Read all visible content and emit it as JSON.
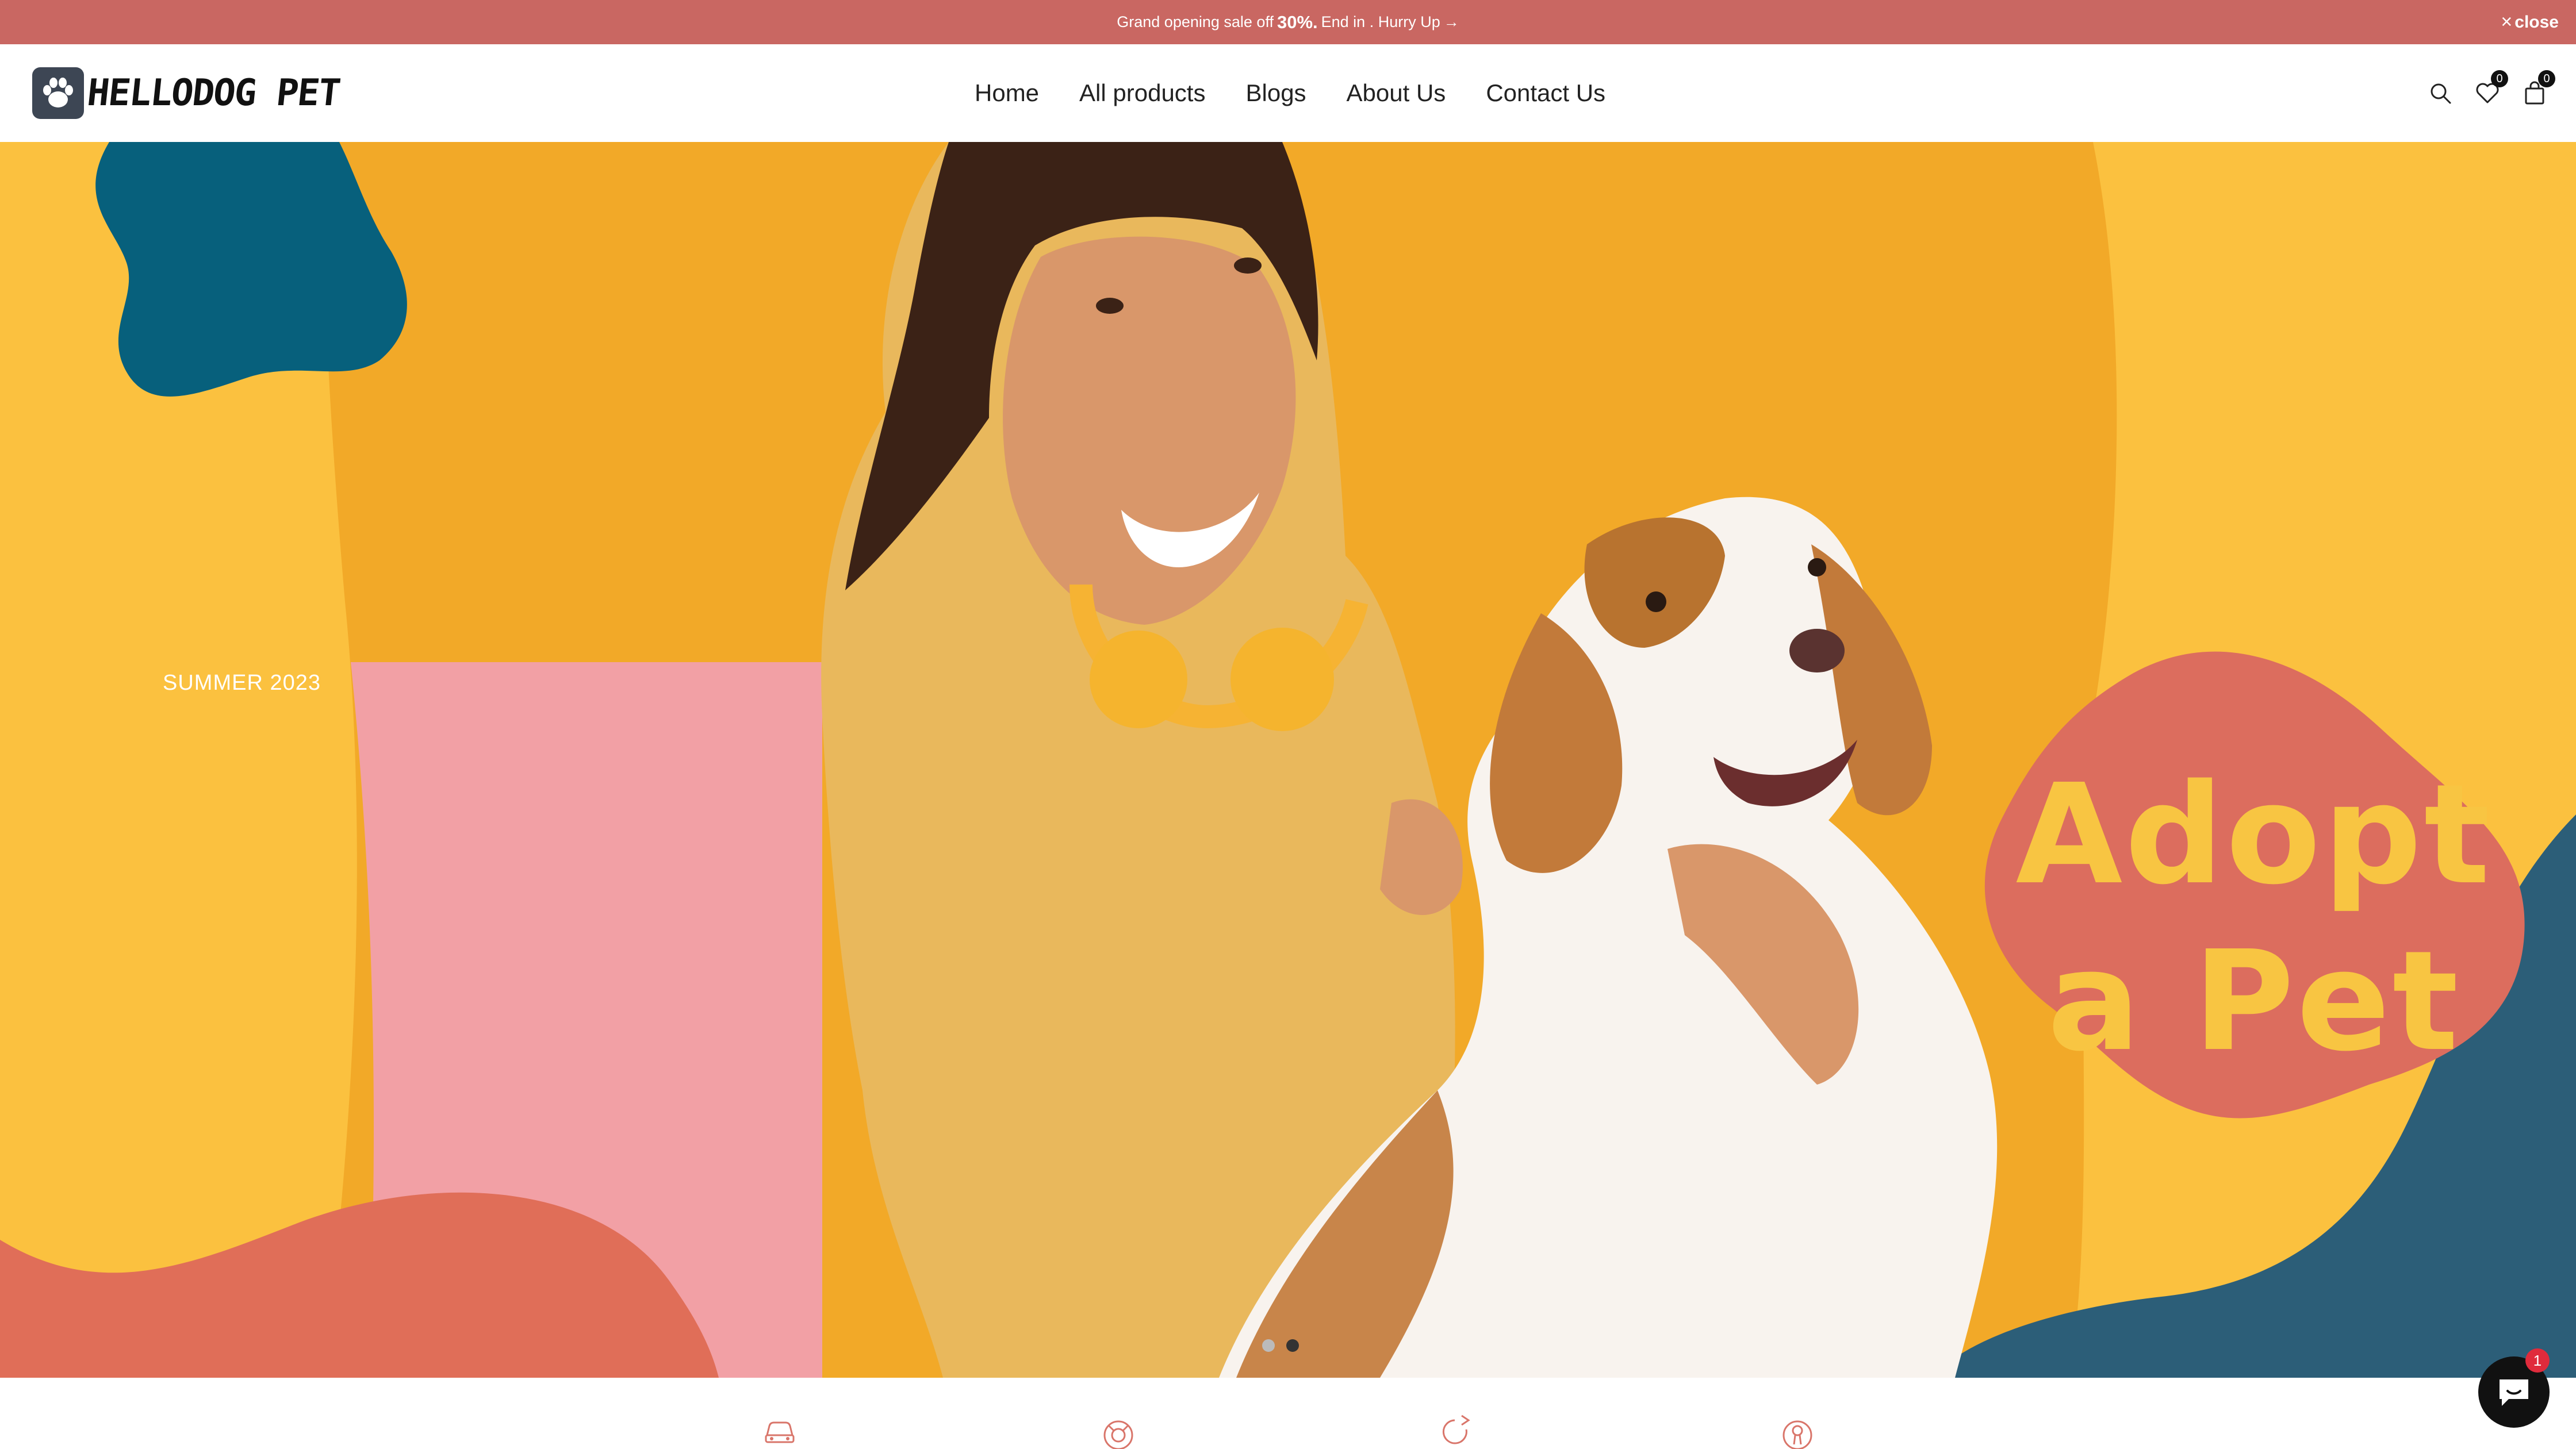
{
  "announcement": {
    "prefix": "Grand opening sale off",
    "discount": "30%.",
    "suffix": "End in . Hurry Up",
    "arrow": "→",
    "close_label": "close",
    "close_icon": "×"
  },
  "header": {
    "logo_text": "HELLODOG PET",
    "logo_icon": "paw-icon",
    "nav": [
      {
        "label": "Home"
      },
      {
        "label": "All products"
      },
      {
        "label": "Blogs"
      },
      {
        "label": "About Us"
      },
      {
        "label": "Contact Us"
      }
    ],
    "wishlist_count": "0",
    "cart_count": "0"
  },
  "hero": {
    "season": "SUMMER 2023",
    "headline_line1": "Adopt",
    "headline_line2": "a Pet",
    "slide_count": 2,
    "active_slide": 2,
    "colors": {
      "orange": "#f2a928",
      "yellow": "#fbc13f",
      "pink": "#f2a0a5",
      "coral": "#e06e58",
      "teal": "#2c5e78",
      "dark_teal": "#07607c",
      "badge_red": "#dc6d5e",
      "headline": "#f8c542"
    }
  },
  "features": [
    {
      "icon": "car-icon"
    },
    {
      "icon": "lifebuoy-icon"
    },
    {
      "icon": "return-arrow-icon"
    },
    {
      "icon": "award-icon"
    }
  ],
  "chat": {
    "icon": "chat-bubble-icon",
    "unread": "1"
  }
}
